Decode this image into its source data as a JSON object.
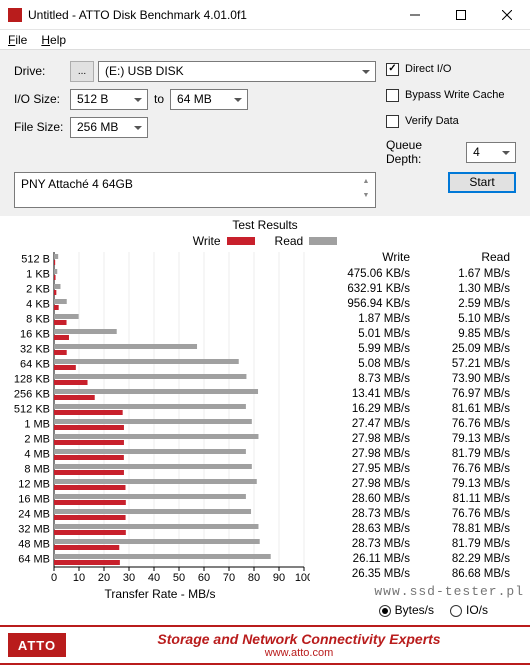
{
  "window": {
    "title": "Untitled - ATTO Disk Benchmark 4.01.0f1"
  },
  "menu": {
    "file": "File",
    "help": "Help"
  },
  "form": {
    "drive_label": "Drive:",
    "browse": "...",
    "drive_value": "(E:) USB DISK",
    "io_label": "I/O Size:",
    "io_from": "512 B",
    "to": "to",
    "io_to": "64 MB",
    "fs_label": "File Size:",
    "fs_value": "256 MB",
    "direct_io": "Direct I/O",
    "bypass": "Bypass Write Cache",
    "verify": "Verify Data",
    "qd_label": "Queue Depth:",
    "qd_value": "4"
  },
  "description": "PNY Attaché 4 64GB",
  "start": "Start",
  "results": {
    "title": "Test Results",
    "write_label": "Write",
    "read_label": "Read",
    "xaxis": "Transfer Rate - MB/s",
    "bytes": "Bytes/s",
    "ios": "IO/s"
  },
  "chart_data": {
    "type": "bar",
    "orientation": "horizontal",
    "categories": [
      "512 B",
      "1 KB",
      "2 KB",
      "4 KB",
      "8 KB",
      "16 KB",
      "32 KB",
      "64 KB",
      "128 KB",
      "256 KB",
      "512 KB",
      "1 MB",
      "2 MB",
      "4 MB",
      "8 MB",
      "12 MB",
      "16 MB",
      "24 MB",
      "32 MB",
      "48 MB",
      "64 MB"
    ],
    "xlabel": "Transfer Rate - MB/s",
    "xlim": [
      0,
      100
    ],
    "xticks": [
      0,
      10,
      20,
      30,
      40,
      50,
      60,
      70,
      80,
      90,
      100
    ],
    "series": [
      {
        "name": "Write",
        "color": "#c8202c",
        "display_unit": [
          "KB/s",
          "KB/s",
          "KB/s",
          "MB/s",
          "MB/s",
          "MB/s",
          "MB/s",
          "MB/s",
          "MB/s",
          "MB/s",
          "MB/s",
          "MB/s",
          "MB/s",
          "MB/s",
          "MB/s",
          "MB/s",
          "MB/s",
          "MB/s",
          "MB/s",
          "MB/s",
          "MB/s"
        ],
        "display_values": [
          "475.06",
          "632.91",
          "956.94",
          "1.87",
          "5.01",
          "5.99",
          "5.08",
          "8.73",
          "13.41",
          "16.29",
          "27.47",
          "27.98",
          "27.98",
          "27.95",
          "27.98",
          "28.60",
          "28.73",
          "28.63",
          "28.73",
          "26.11",
          "26.35"
        ],
        "values_mb": [
          0.464,
          0.618,
          0.935,
          1.87,
          5.01,
          5.99,
          5.08,
          8.73,
          13.41,
          16.29,
          27.47,
          27.98,
          27.98,
          27.95,
          27.98,
          28.6,
          28.73,
          28.63,
          28.73,
          26.11,
          26.35
        ]
      },
      {
        "name": "Read",
        "color": "#a0a0a0",
        "display_unit": [
          "MB/s",
          "MB/s",
          "MB/s",
          "MB/s",
          "MB/s",
          "MB/s",
          "MB/s",
          "MB/s",
          "MB/s",
          "MB/s",
          "MB/s",
          "MB/s",
          "MB/s",
          "MB/s",
          "MB/s",
          "MB/s",
          "MB/s",
          "MB/s",
          "MB/s",
          "MB/s",
          "MB/s"
        ],
        "display_values": [
          "1.67",
          "1.30",
          "2.59",
          "5.10",
          "9.85",
          "25.09",
          "57.21",
          "73.90",
          "76.97",
          "81.61",
          "76.76",
          "79.13",
          "81.79",
          "76.76",
          "79.13",
          "81.11",
          "76.76",
          "78.81",
          "81.79",
          "82.29",
          "86.68"
        ],
        "values_mb": [
          1.67,
          1.3,
          2.59,
          5.1,
          9.85,
          25.09,
          57.21,
          73.9,
          76.97,
          81.61,
          76.76,
          79.13,
          81.79,
          76.76,
          79.13,
          81.11,
          76.76,
          78.81,
          81.79,
          82.29,
          86.68
        ]
      }
    ]
  },
  "footer": {
    "logo": "ATTO",
    "main": "Storage and Network Connectivity Experts",
    "sub": "www.atto.com"
  },
  "watermark": "www.ssd-tester.pl"
}
